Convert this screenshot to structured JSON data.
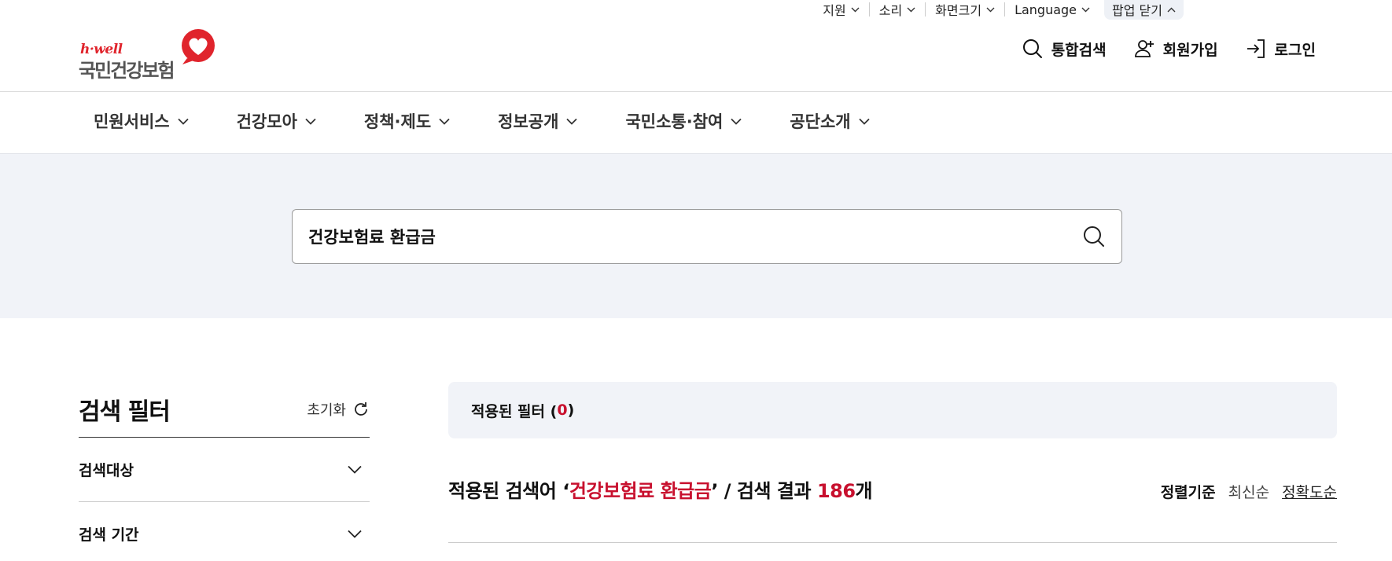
{
  "utility": {
    "items": [
      {
        "label": "지원"
      },
      {
        "label": "소리"
      },
      {
        "label": "화면크기"
      },
      {
        "label": "Language"
      }
    ],
    "popup_close": "팝업 닫기"
  },
  "logo": {
    "tagline": "h·well",
    "name": "국민건강보험"
  },
  "header_actions": {
    "search": "통합검색",
    "signup": "회원가입",
    "login": "로그인"
  },
  "gnb": [
    {
      "label": "민원서비스"
    },
    {
      "label": "건강모아"
    },
    {
      "label": "정책·제도"
    },
    {
      "label": "정보공개"
    },
    {
      "label": "국민소통·참여"
    },
    {
      "label": "공단소개"
    }
  ],
  "search": {
    "value": "건강보험료 환급금"
  },
  "filter": {
    "title": "검색 필터",
    "reset": "초기화",
    "sections": [
      {
        "label": "검색대상"
      },
      {
        "label": "검색 기간"
      }
    ]
  },
  "applied_filter": {
    "prefix": "적용된 필터 (",
    "count": "0",
    "suffix": ")"
  },
  "summary": {
    "prefix": "적용된 검색어 ‘",
    "keyword": "건강보험료 환급금",
    "middle": "’ / 검색 결과 ",
    "count": "186",
    "suffix": "개"
  },
  "sort": {
    "label": "정렬기준",
    "options": [
      {
        "label": "최신순",
        "active": false
      },
      {
        "label": "정확도순",
        "active": true
      }
    ]
  },
  "colors": {
    "accent_red": "#c8102e",
    "panel_bg": "#f1f3f8",
    "logo_red": "#e0242c"
  }
}
